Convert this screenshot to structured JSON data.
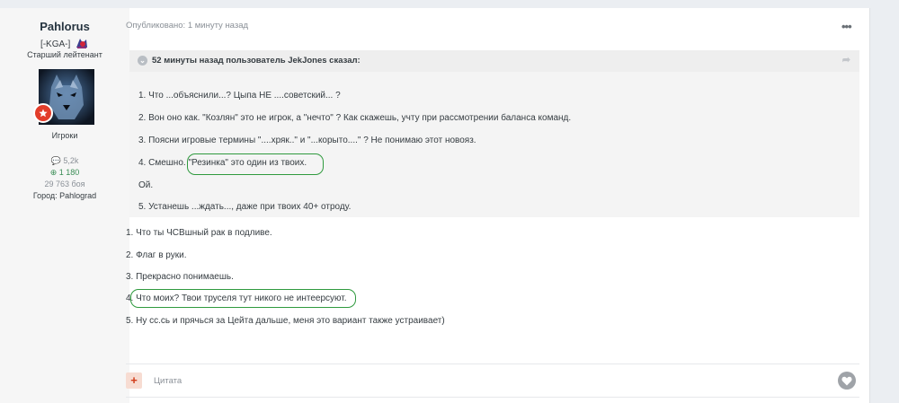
{
  "author": {
    "name": "Pahlorus",
    "clan": "[-KGA-]",
    "rank": "Старший лейтенант",
    "group": "Игроки",
    "posts": "5,2k",
    "reputation": "1 180",
    "battles": "29 763 боя",
    "city": "Город: Pahlograd"
  },
  "post": {
    "published": "Опубликовано: 1 минуту назад",
    "more": "•••"
  },
  "quote": {
    "header": "52 минуты назад пользователь JekJones сказал:",
    "lines": [
      "1. Что ...объяснили...? Цыпа НЕ ....советский... ?",
      "2. Вон оно как. \"Козлян\" это не игрок, а \"нечто\" ? Как скажешь, учту при рассмотрении баланса команд.",
      "3. Поясни игровые термины \"....хряк..\" и \"...корыто....\" ? Не понимаю этот новояз.",
      "4. Смешно. \"Резинка\" это один из твоих.",
      "Ой.",
      "5. Устанешь ...ждать..., даже при твоих 40+ отроду."
    ]
  },
  "reply": {
    "lines": [
      "1. Что ты ЧСВшный рак в подливе.",
      "2. Флаг в руки.",
      "3. Прекрасно понимаешь.",
      "4. Что моих? Твои труселя тут никого не интеерсуют.",
      "5. Ну сс.сь и прячься за Цейта дальше, меня это  вариант также устраивает)"
    ]
  },
  "footer": {
    "plus": "+",
    "quote_label": "Цитата"
  },
  "colors": {
    "highlight": "#2f9a3e",
    "badge": "#e23d2a",
    "reputation": "#3a8d55"
  }
}
